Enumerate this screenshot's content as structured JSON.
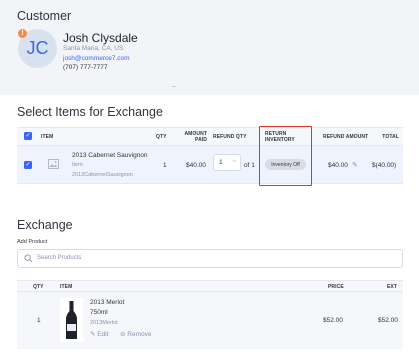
{
  "customer": {
    "section_title": "Customer",
    "initials": "JC",
    "badge": "!",
    "name": "Josh Clysdale",
    "location": "Santa Maria, CA, US",
    "email": "josh@commerce7.com",
    "phone": "(707) 777-7777"
  },
  "exchange_items": {
    "section_title": "Select Items for Exchange",
    "columns": {
      "item": "ITEM",
      "qty": "QTY",
      "amount_paid_1": "AMOUNT",
      "amount_paid_2": "PAID",
      "refund_qty": "REFUND QTY",
      "return_inventory_1": "RETURN",
      "return_inventory_2": "INVENTORY",
      "refund_amount": "REFUND AMOUNT",
      "total": "TOTAL"
    },
    "rows": [
      {
        "name": "2013 Cabernet Sauvignon",
        "type": "Item",
        "sku": "2013CabernetSauvignon",
        "qty": "1",
        "amount_paid": "$40.00",
        "refund_qty": "1",
        "refund_qty_of": "of 1",
        "return_inventory": "Inventory Off",
        "refund_amount": "$40.00",
        "total": "$(40.00)"
      }
    ]
  },
  "exchange": {
    "section_title": "Exchange",
    "add_product_label": "Add Product",
    "search_placeholder": "Search Products",
    "columns": {
      "qty": "QTY",
      "item": "ITEM",
      "price": "PRICE",
      "ext": "EXT"
    },
    "rows": [
      {
        "qty": "1",
        "name": "2013 Merlot",
        "size": "750ml",
        "sku": "2013Merlot",
        "edit_label": "Edit",
        "remove_label": "Remove",
        "price": "$52.00",
        "ext": "$52.00"
      }
    ]
  },
  "colors": {
    "accent": "#3c64f4",
    "badge": "#f78e3f",
    "highlight_border": "#d43b2e",
    "selected_row": "#eef3fd"
  }
}
